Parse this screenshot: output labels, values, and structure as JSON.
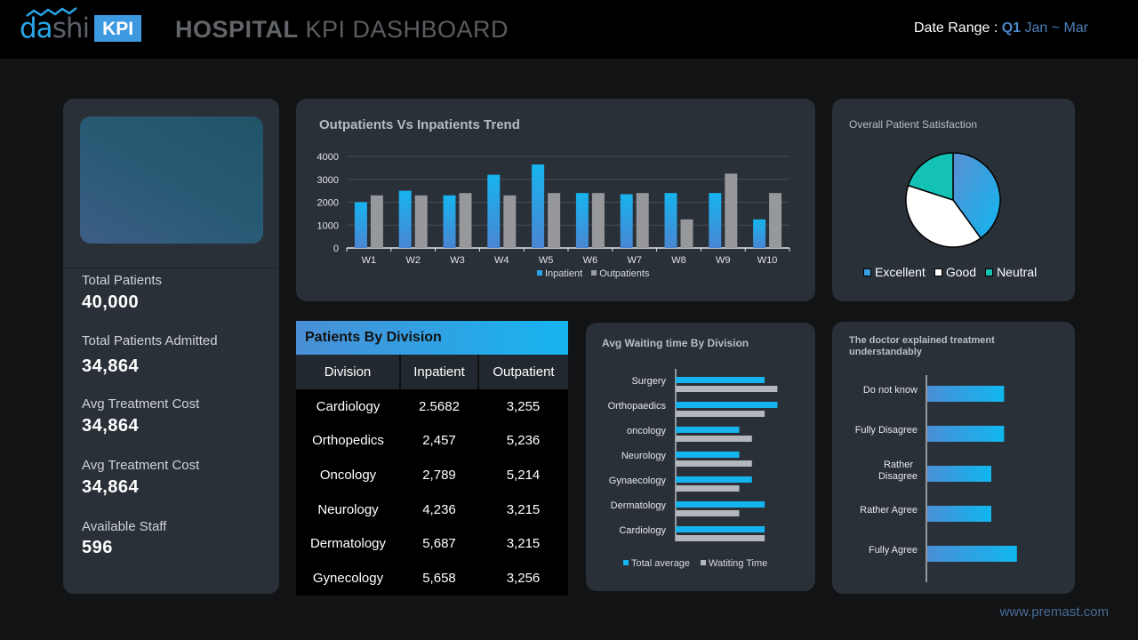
{
  "header": {
    "logo_part1": "da",
    "logo_part2": "shi",
    "logo_badge": "KPI",
    "title_bold": "HOSPITAL",
    "title_light": " KPI DASHBOARD",
    "date_range_label": "Date Range : ",
    "date_range_quarter": "Q1",
    "date_range_months": " Jan ~ Mar"
  },
  "kpis": [
    {
      "label": "Total Patients",
      "value": "40,000"
    },
    {
      "label": "Total Patients Admitted",
      "value": "34,864"
    },
    {
      "label": "Avg Treatment Cost",
      "value": "34,864"
    },
    {
      "label": "Avg Treatment Cost",
      "value": "34,864"
    },
    {
      "label": "Available Staff",
      "value": "596"
    }
  ],
  "colors": {
    "accent_blue": "#16b4ef",
    "accent_blue_dark": "#4a8fd6",
    "gray_series": "#9a9c9f",
    "teal": "#14c2b4",
    "panel_bg": "#2a3038",
    "page_bg": "#111315"
  },
  "table": {
    "title": "Patients By Division",
    "columns": [
      "Division",
      "Inpatient",
      "Outpatient"
    ],
    "rows": [
      [
        "Cardiology",
        "2.5682",
        "3,255"
      ],
      [
        "Orthopedics",
        "2,457",
        "5,236"
      ],
      [
        "Oncology",
        "2,789",
        "5,214"
      ],
      [
        "Neurology",
        "4,236",
        "3,215"
      ],
      [
        "Dermatology",
        "5,687",
        "3,215"
      ],
      [
        "Gynecology",
        "5,658",
        "3,256"
      ]
    ]
  },
  "footer": {
    "url": "www.premast.com"
  },
  "chart_data": [
    {
      "id": "trend",
      "type": "bar",
      "title": "Outpatients Vs Inpatients Trend",
      "categories": [
        "W1",
        "W2",
        "W3",
        "W4",
        "W5",
        "W6",
        "W7",
        "W8",
        "W9",
        "W10"
      ],
      "series": [
        {
          "name": "Inpatient",
          "values": [
            2000,
            2500,
            2300,
            3200,
            3650,
            2400,
            2350,
            2400,
            2400,
            1250
          ]
        },
        {
          "name": "Outpatients",
          "values": [
            2300,
            2300,
            2400,
            2300,
            2400,
            2400,
            2400,
            1250,
            3250,
            2400
          ]
        }
      ],
      "yticks": [
        0,
        1000,
        2000,
        3000,
        4000
      ],
      "ylim": [
        0,
        4000
      ],
      "grid": true,
      "legend": "bottom"
    },
    {
      "id": "satisfaction",
      "type": "pie",
      "title": "Overall Patient Satisfaction",
      "labels": [
        "Excellent",
        "Good",
        "Neutral"
      ],
      "values": [
        40,
        40,
        20
      ],
      "legend": "bottom"
    },
    {
      "id": "waiting",
      "type": "bar",
      "orientation": "horizontal",
      "title": "Avg Waiting time By Division",
      "categories": [
        "Surgery",
        "Orthopaedics",
        "oncology",
        "Neurology",
        "Gynaecology",
        "Dermatology",
        "Cardiology"
      ],
      "series": [
        {
          "name": "Total average",
          "values": [
            7,
            8,
            5,
            5,
            6,
            7,
            7
          ]
        },
        {
          "name": "Watiting Time",
          "values": [
            8,
            7,
            6,
            6,
            5,
            5,
            7
          ]
        }
      ],
      "xlim": [
        0,
        10
      ],
      "legend": "bottom"
    },
    {
      "id": "doctor",
      "type": "bar",
      "orientation": "horizontal",
      "title": "The doctor explained treatment understandably",
      "categories": [
        "Do not know",
        "Fully Disagree",
        "Rather Disagree",
        "Rather Agree",
        "Fully Agree"
      ],
      "values": [
        6,
        6,
        5,
        5,
        7
      ],
      "xlim": [
        0,
        10
      ]
    }
  ]
}
